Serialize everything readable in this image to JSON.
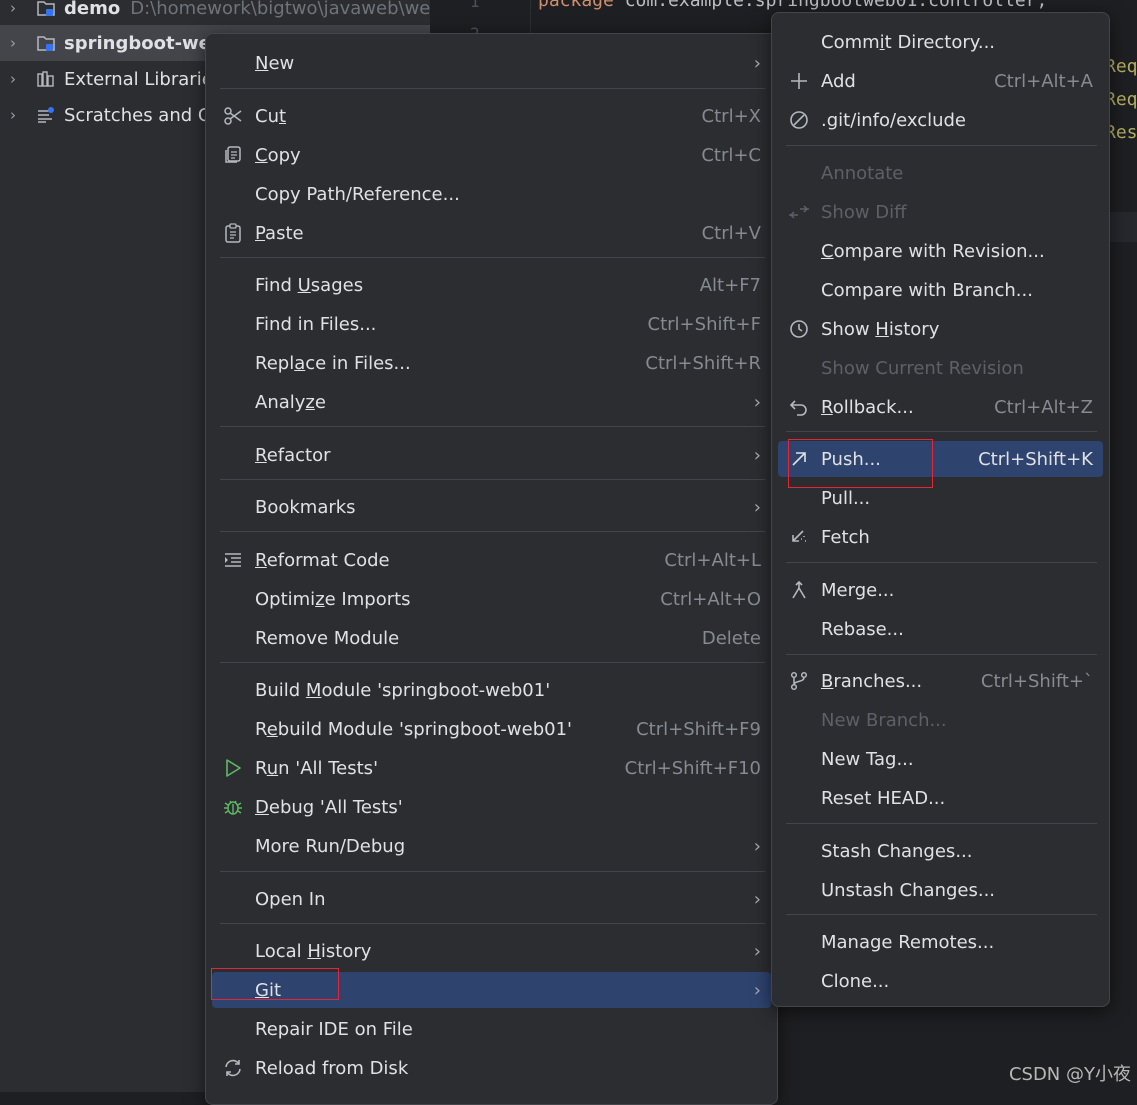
{
  "project_tree": {
    "rows": [
      {
        "label": "demo",
        "path": "D:\\homework\\bigtwo\\javaweb\\we",
        "icon": "module-folder-icon"
      },
      {
        "label": "springboot-we",
        "icon": "module-folder-icon"
      },
      {
        "label": "External Librarie",
        "icon": "libraries-icon"
      },
      {
        "label": "Scratches and C",
        "icon": "scratches-icon"
      }
    ]
  },
  "editor": {
    "line_numbers": [
      "1",
      "2"
    ],
    "keyword": "package",
    "package_text": " com.example.springbootweb01.controller;",
    "right_fragments": [
      "Req",
      "Req",
      "Res"
    ]
  },
  "context_menu": {
    "items": {
      "new": {
        "pre": "",
        "u": "N",
        "post": "ew"
      },
      "cut": {
        "pre": "Cu",
        "u": "t",
        "post": "",
        "shortcut": "Ctrl+X"
      },
      "copy": {
        "pre": "",
        "u": "C",
        "post": "opy",
        "shortcut": "Ctrl+C"
      },
      "copy_path": {
        "label": "Copy Path/Reference..."
      },
      "paste": {
        "pre": "",
        "u": "P",
        "post": "aste",
        "shortcut": "Ctrl+V"
      },
      "find_usages": {
        "pre": "Find ",
        "u": "U",
        "post": "sages",
        "shortcut": "Alt+F7"
      },
      "find_in_files": {
        "label": "Find in Files...",
        "shortcut": "Ctrl+Shift+F"
      },
      "replace_in_files": {
        "pre": "Repl",
        "u": "a",
        "post": "ce in Files...",
        "shortcut": "Ctrl+Shift+R"
      },
      "analyze": {
        "pre": "Analy",
        "u": "z",
        "post": "e"
      },
      "refactor": {
        "pre": "",
        "u": "R",
        "post": "efactor"
      },
      "bookmarks": {
        "label": "Bookmarks"
      },
      "reformat": {
        "pre": "",
        "u": "R",
        "post": "eformat Code",
        "shortcut": "Ctrl+Alt+L"
      },
      "optimize": {
        "pre": "Optimi",
        "u": "z",
        "post": "e Imports",
        "shortcut": "Ctrl+Alt+O"
      },
      "remove_module": {
        "label": "Remove Module",
        "shortcut": "Delete"
      },
      "build_module": {
        "pre": "Build ",
        "u": "M",
        "post": "odule 'springboot-web01'"
      },
      "rebuild_module": {
        "pre": "R",
        "u": "e",
        "post": "build Module 'springboot-web01'",
        "shortcut": "Ctrl+Shift+F9"
      },
      "run_tests": {
        "pre": "R",
        "u": "u",
        "post": "n 'All Tests'",
        "shortcut": "Ctrl+Shift+F10"
      },
      "debug_tests": {
        "pre": "",
        "u": "D",
        "post": "ebug 'All Tests'"
      },
      "more_run": {
        "label": "More Run/Debug"
      },
      "open_in": {
        "label": "Open In"
      },
      "local_history": {
        "pre": "Local ",
        "u": "H",
        "post": "istory"
      },
      "git": {
        "pre": "",
        "u": "G",
        "post": "it"
      },
      "repair_ide": {
        "label": "Repair IDE on File"
      },
      "reload": {
        "label": "Reload from Disk"
      }
    },
    "submenu_arrow": "›"
  },
  "git_menu": {
    "items": {
      "commit_dir": {
        "pre": "Comm",
        "u": "i",
        "post": "t Directory..."
      },
      "add": {
        "label": "Add",
        "shortcut": "Ctrl+Alt+A"
      },
      "exclude": {
        "label": ".git/info/exclude"
      },
      "annotate": {
        "label": "Annotate"
      },
      "show_diff": {
        "label": "Show Diff"
      },
      "compare_revision": {
        "pre": "",
        "u": "C",
        "post": "ompare with Revision..."
      },
      "compare_branch": {
        "label": "Compare with Branch..."
      },
      "show_history": {
        "pre": "Show ",
        "u": "H",
        "post": "istory"
      },
      "show_current": {
        "label": "Show Current Revision"
      },
      "rollback": {
        "pre": "",
        "u": "R",
        "post": "ollback...",
        "shortcut": "Ctrl+Alt+Z"
      },
      "push": {
        "label": "Push...",
        "shortcut": "Ctrl+Shift+K"
      },
      "pull": {
        "label": "Pull..."
      },
      "fetch": {
        "label": "Fetch"
      },
      "merge": {
        "label": "Merge..."
      },
      "rebase": {
        "label": "Rebase..."
      },
      "branches": {
        "pre": "",
        "u": "B",
        "post": "ranches...",
        "shortcut": "Ctrl+Shift+`"
      },
      "new_branch": {
        "label": "New Branch..."
      },
      "new_tag": {
        "label": "New Tag..."
      },
      "reset_head": {
        "label": "Reset HEAD..."
      },
      "stash": {
        "label": "Stash Changes..."
      },
      "unstash": {
        "label": "Unstash Changes..."
      },
      "manage_remotes": {
        "label": "Manage Remotes..."
      },
      "clone": {
        "label": "Clone..."
      }
    }
  },
  "watermark": "CSDN @Y小夜",
  "colors": {
    "highlight": "#2e436e",
    "annotation_box": "#e0283a",
    "run_icon": "#5fb865",
    "debug_icon": "#5fb865"
  }
}
